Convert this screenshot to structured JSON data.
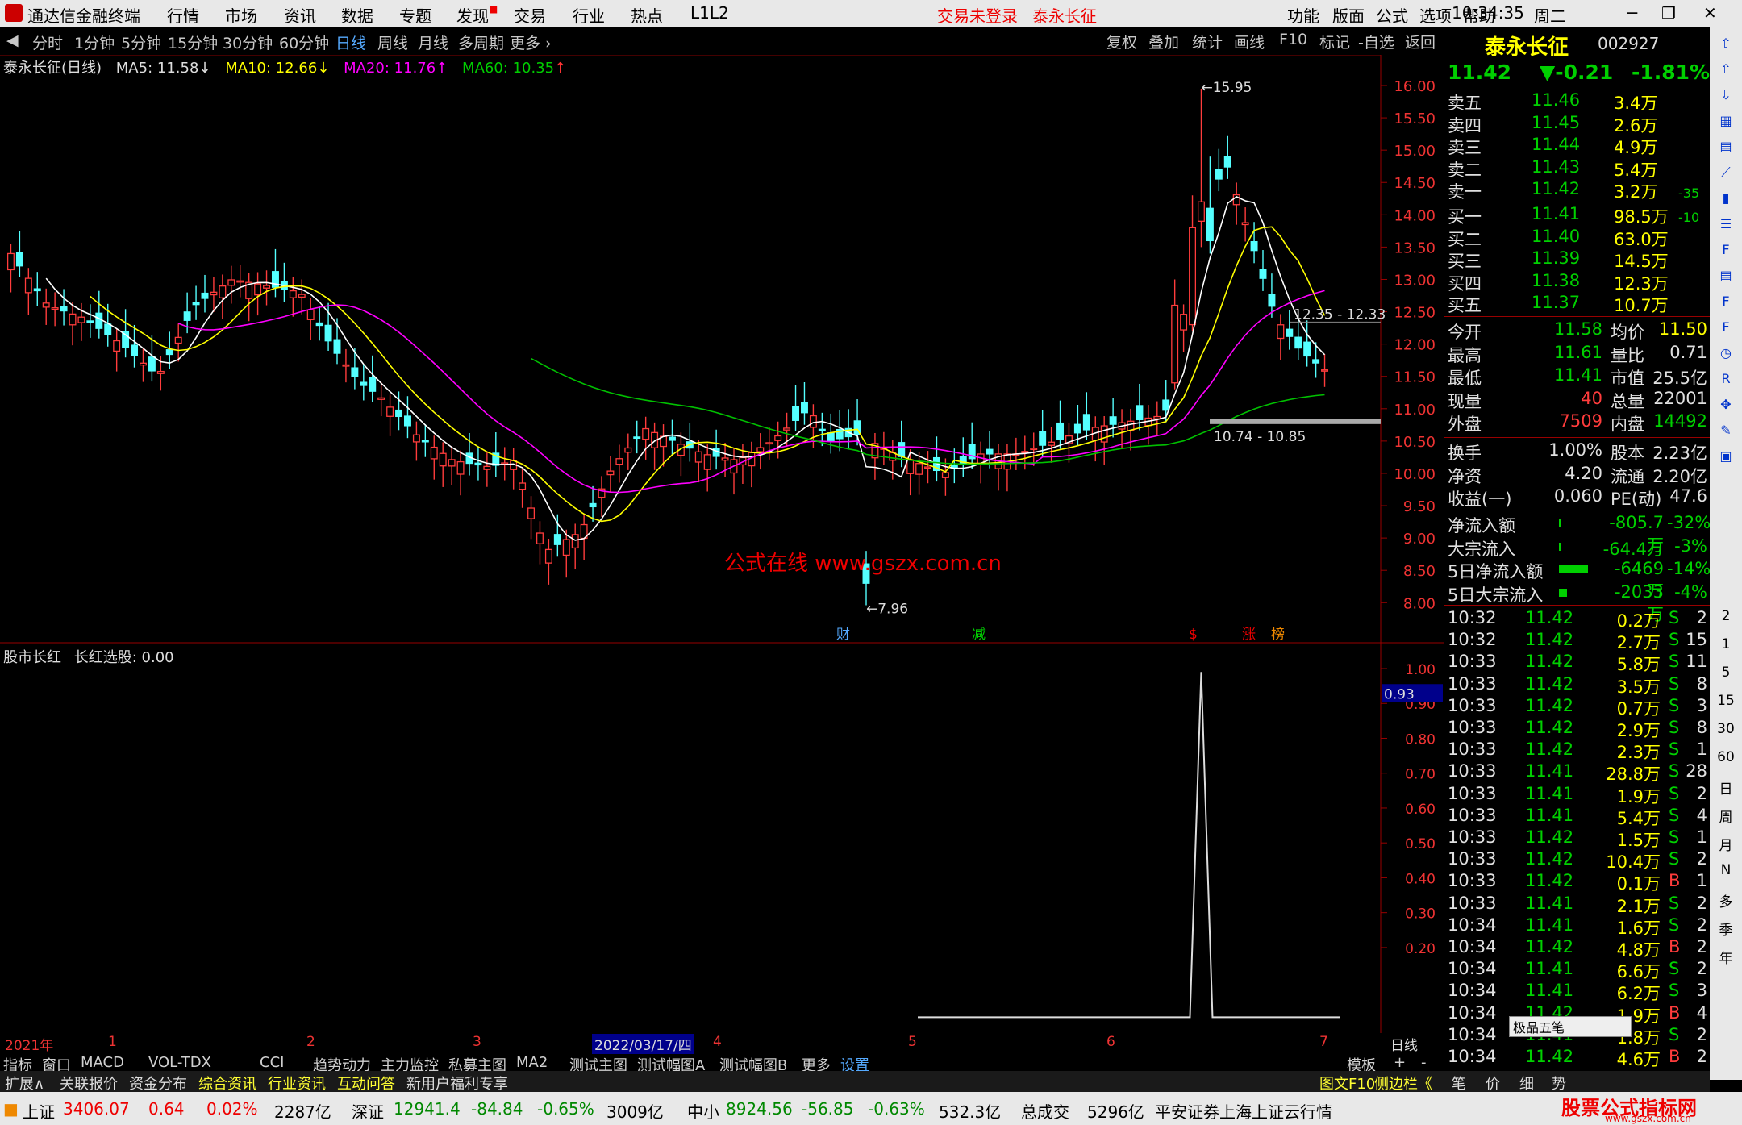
{
  "app": {
    "title": "通达信金融终端",
    "status_login": "交易未登录",
    "stock_title": "泰永长征",
    "clock": "10:34:35",
    "weekday": "周二"
  },
  "menu": [
    "行情",
    "市场",
    "资讯",
    "数据",
    "专题",
    "发现",
    "交易",
    "行业",
    "热点",
    "L1L2"
  ],
  "right_menu": [
    "功能",
    "版面",
    "公式",
    "选项",
    "帮助"
  ],
  "periods": [
    "分时",
    "1分钟",
    "5分钟",
    "15分钟",
    "30分钟",
    "60分钟",
    "日线",
    "周线",
    "月线",
    "多周期",
    "更多"
  ],
  "toolbar_right": [
    "复权",
    "叠加",
    "统计",
    "画线",
    "F10",
    "标记",
    "-自选",
    "返回"
  ],
  "main_legend": {
    "name": "泰永长征(日线)",
    "ma5": "MA5: 11.58",
    "ma10": "MA10: 12.66",
    "ma20": "MA20: 11.76",
    "ma60": "MA60: 10.35"
  },
  "price_axis": [
    "16.00",
    "15.50",
    "15.00",
    "14.50",
    "14.00",
    "13.50",
    "13.00",
    "12.50",
    "12.00",
    "11.50",
    "11.00",
    "10.50",
    "10.00",
    "9.50",
    "9.00",
    "8.50",
    "8.00"
  ],
  "annotations": {
    "high": "15.95",
    "low": "7.96",
    "band1": "12.35 - 12.33",
    "band2": "10.74 - 10.85",
    "watermark": "公式在线 www.gszx.com.cn"
  },
  "event_tags": [
    {
      "label": "财"
    },
    {
      "label": "减"
    },
    {
      "label": "$"
    },
    {
      "label": "涨"
    },
    {
      "label": "榜"
    }
  ],
  "sub_legend": {
    "name": "股市长红",
    "value": "长红选股: 0.00"
  },
  "sub_axis": [
    "1.00",
    "0.90",
    "0.80",
    "0.70",
    "0.60",
    "0.50",
    "0.40",
    "0.30",
    "0.20"
  ],
  "sub_current": "0.93",
  "date_axis": {
    "year": "2021年",
    "months": [
      "1",
      "2",
      "3",
      "4",
      "5",
      "6",
      "7"
    ],
    "cursor": "2022/03/17/四",
    "period_label": "日线"
  },
  "quote": {
    "name": "泰永长征",
    "code": "002927",
    "price": "11.42",
    "change": "▼-0.21",
    "pct": "-1.81%",
    "asks": [
      [
        "卖五",
        "11.46",
        "3.4万"
      ],
      [
        "卖四",
        "11.45",
        "2.6万"
      ],
      [
        "卖三",
        "11.44",
        "4.9万"
      ],
      [
        "卖二",
        "11.43",
        "5.4万"
      ],
      [
        "卖一",
        "11.42",
        "3.2万"
      ]
    ],
    "ask_note": "-35",
    "bids": [
      [
        "买一",
        "11.41",
        "98.5万"
      ],
      [
        "买二",
        "11.40",
        "63.0万"
      ],
      [
        "买三",
        "11.39",
        "14.5万"
      ],
      [
        "买四",
        "11.38",
        "12.3万"
      ],
      [
        "买五",
        "11.37",
        "10.7万"
      ]
    ],
    "bid_note": "-10",
    "stats": [
      [
        "今开",
        "11.58",
        "均价",
        "11.50"
      ],
      [
        "最高",
        "11.61",
        "量比",
        "0.71"
      ],
      [
        "最低",
        "11.41",
        "市值",
        "25.5亿"
      ],
      [
        "现量",
        "40",
        "总量",
        "22001"
      ],
      [
        "外盘",
        "7509",
        "内盘",
        "14492"
      ]
    ],
    "fin": [
      [
        "换手",
        "1.00%",
        "股本",
        "2.23亿"
      ],
      [
        "净资",
        "4.20",
        "流通",
        "2.20亿"
      ],
      [
        "收益(一)",
        "0.060",
        "PE(动)",
        "47.6"
      ]
    ],
    "flows": [
      [
        "净流入额",
        "-805.7万",
        "-32%"
      ],
      [
        "大宗流入",
        "-64.4万",
        "-3%"
      ],
      [
        "5日净流入额",
        "-6469万",
        "-14%"
      ],
      [
        "5日大宗流入",
        "-2033万",
        "-4%"
      ]
    ],
    "ticks": [
      [
        "10:32",
        "11.42",
        "0.2万",
        "S",
        "2"
      ],
      [
        "10:32",
        "11.42",
        "2.7万",
        "S",
        "15"
      ],
      [
        "10:33",
        "11.42",
        "5.8万",
        "S",
        "11"
      ],
      [
        "10:33",
        "11.42",
        "3.5万",
        "S",
        "8"
      ],
      [
        "10:33",
        "11.42",
        "0.7万",
        "S",
        "3"
      ],
      [
        "10:33",
        "11.42",
        "2.9万",
        "S",
        "8"
      ],
      [
        "10:33",
        "11.42",
        "2.3万",
        "S",
        "1"
      ],
      [
        "10:33",
        "11.41",
        "28.8万",
        "S",
        "28"
      ],
      [
        "10:33",
        "11.41",
        "1.9万",
        "S",
        "2"
      ],
      [
        "10:33",
        "11.41",
        "5.4万",
        "S",
        "4"
      ],
      [
        "10:33",
        "11.42",
        "1.5万",
        "S",
        "1"
      ],
      [
        "10:33",
        "11.42",
        "10.4万",
        "S",
        "2"
      ],
      [
        "10:33",
        "11.42",
        "0.1万",
        "B",
        "1"
      ],
      [
        "10:33",
        "11.41",
        "2.1万",
        "S",
        "2"
      ],
      [
        "10:34",
        "11.41",
        "1.6万",
        "S",
        "2"
      ],
      [
        "10:34",
        "11.42",
        "4.8万",
        "B",
        "2"
      ],
      [
        "10:34",
        "11.41",
        "6.6万",
        "S",
        "2"
      ],
      [
        "10:34",
        "11.41",
        "6.2万",
        "S",
        "3"
      ],
      [
        "10:34",
        "11.42",
        "1.9万",
        "B",
        "4"
      ],
      [
        "10:34",
        "11.41",
        "1.8万",
        "S",
        "2"
      ],
      [
        "10:34",
        "11.42",
        "4.6万",
        "B",
        "2"
      ]
    ]
  },
  "popup": "极品五笔",
  "tabs1": [
    "指标",
    "窗口",
    "MACD",
    "VOL-TDX",
    "CCI",
    "趋势动力",
    "主力监控",
    "私募主图",
    "MA2",
    "测试主图",
    "测试幅图A",
    "测试幅图B",
    "更多",
    "设置"
  ],
  "tabs1_right": [
    "模板",
    "+",
    "-"
  ],
  "tabs2": [
    "扩展∧",
    "关联报价",
    "资金分布",
    "综合资讯",
    "行业资讯",
    "互动问答",
    "新用户福利专享"
  ],
  "tabs2_right": [
    "图文F10",
    "侧边栏《",
    "笔",
    "价",
    "细",
    "势"
  ],
  "status": {
    "sh_label": "上证",
    "sh": "3406.07",
    "sh_chg": "0.64",
    "sh_pct": "0.02%",
    "sh_amt": "2287亿",
    "sz_label": "深证",
    "sz": "12941.4",
    "sz_chg": "-84.84",
    "sz_pct": "-0.65%",
    "sz_amt": "3009亿",
    "zx_label": "中小",
    "zx": "8924.56",
    "zx_chg": "-56.85",
    "zx_pct": "-0.63%",
    "zx_amt": "532.3亿",
    "total_label": "总成交",
    "total": "5296亿",
    "feed": "平安证券上海上证云行情",
    "brand": "股票公式指标网",
    "brand_url": "www.gszx.com.cn"
  },
  "sidebar_icons": [
    "up-arrow-icon",
    "up-arrow-icon",
    "down-arrow-icon",
    "chart-icon",
    "grid-icon",
    "line-icon",
    "candle-icon",
    "list-icon",
    "f10-icon",
    "doc-icon",
    "f2-icon",
    "f5-icon",
    "clock-icon",
    "rsi-icon",
    "move-icon",
    "pen-icon",
    "fs-icon"
  ],
  "sidebar_labels": [
    "2",
    "1",
    "5",
    "15",
    "30",
    "60",
    "日",
    "周",
    "月",
    "N",
    "多",
    "季",
    "年"
  ]
}
